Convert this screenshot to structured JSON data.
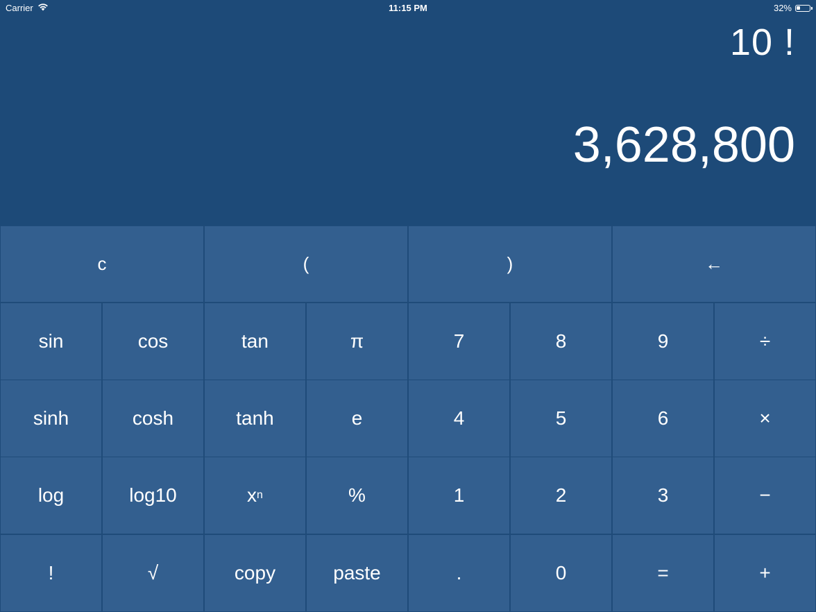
{
  "status_bar": {
    "carrier": "Carrier",
    "time": "11:15 PM",
    "battery_percent_label": "32%",
    "battery_level": 0.32,
    "wifi_icon": "wifi-icon",
    "battery_icon": "battery-icon"
  },
  "display": {
    "expression": "10 !",
    "result": "3,628,800"
  },
  "keys": {
    "row1": [
      "c",
      "(",
      ")",
      "←"
    ],
    "row2": [
      "sin",
      "cos",
      "tan",
      "π",
      "7",
      "8",
      "9",
      "÷"
    ],
    "row3": [
      "sinh",
      "cosh",
      "tanh",
      "e",
      "4",
      "5",
      "6",
      "×"
    ],
    "row4": [
      "log",
      "log10",
      "x",
      "%",
      "1",
      "2",
      "3",
      "−"
    ],
    "row4_sup": "n",
    "row5": [
      "!",
      "√",
      "copy",
      "paste",
      ".",
      "0",
      "=",
      "+"
    ]
  },
  "colors": {
    "background": "#1d4a78",
    "key": "#335f8f",
    "key_border": "#1f4b79",
    "text": "#ffffff"
  }
}
